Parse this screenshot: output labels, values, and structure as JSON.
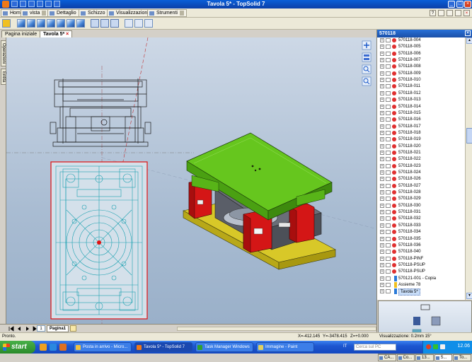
{
  "window": {
    "title": "Tavola 5* - TopSolid 7"
  },
  "menubar": {
    "items": [
      {
        "label": "Home"
      },
      {
        "label": "vista"
      },
      {
        "label": "Dettaglio"
      },
      {
        "label": "Schizzo"
      },
      {
        "label": "Visualizzazione"
      },
      {
        "label": "Strumenti"
      }
    ]
  },
  "tabs": [
    {
      "label": "Pagina iniziale"
    },
    {
      "label": "Tavola 5*"
    }
  ],
  "left_tabs": [
    {
      "label": "Operazioni"
    },
    {
      "label": "Entità"
    }
  ],
  "page_nav": {
    "page_number": "1",
    "sheet_label": "Pagina1"
  },
  "right_panel": {
    "title": "570118",
    "tree": [
      {
        "label": "570118-004"
      },
      {
        "label": "570118-005"
      },
      {
        "label": "570118-006"
      },
      {
        "label": "570118-007"
      },
      {
        "label": "570118-008"
      },
      {
        "label": "570118-009"
      },
      {
        "label": "570118-010"
      },
      {
        "label": "570118-011"
      },
      {
        "label": "570118-012"
      },
      {
        "label": "570118-013"
      },
      {
        "label": "570118-014"
      },
      {
        "label": "570118-015"
      },
      {
        "label": "570118-016"
      },
      {
        "label": "570118-017"
      },
      {
        "label": "570118-018"
      },
      {
        "label": "570118-019"
      },
      {
        "label": "570118-020"
      },
      {
        "label": "570118-021"
      },
      {
        "label": "570118-022"
      },
      {
        "label": "570118-023"
      },
      {
        "label": "570118-024"
      },
      {
        "label": "570118-026"
      },
      {
        "label": "570118-027"
      },
      {
        "label": "570118-028"
      },
      {
        "label": "570118-029"
      },
      {
        "label": "570118-030"
      },
      {
        "label": "570118-031"
      },
      {
        "label": "570118-032"
      },
      {
        "label": "570118-033"
      },
      {
        "label": "570118-034"
      },
      {
        "label": "570118-035"
      },
      {
        "label": "570118-036"
      },
      {
        "label": "570118-040"
      },
      {
        "label": "570118-PINF"
      },
      {
        "label": "570118-PSUP"
      },
      {
        "label": "570118-PSUP"
      },
      {
        "label": "570121-001 - Copia"
      },
      {
        "label": "Assieme 78"
      },
      {
        "label": "Tavola 5*"
      }
    ],
    "bottom_tabs": [
      {
        "label": "CA..."
      },
      {
        "label": "Co..."
      },
      {
        "label": "13..."
      },
      {
        "label": "S..."
      },
      {
        "label": "To..."
      }
    ]
  },
  "status": {
    "left": "Pronto.",
    "x": "X=-412.145",
    "y": "Y=-3478.415",
    "z": "Z=+0.000",
    "visualization": "Visualizzazione: 0.2mm 15°"
  },
  "taskbar": {
    "start": "start",
    "tasks": [
      {
        "label": "Posta in arrivo - Micro..."
      },
      {
        "label": "Tavola 5* - TopSolid 7"
      },
      {
        "label": "Task Manager Windows"
      },
      {
        "label": "Immagine - Paint"
      }
    ],
    "lang": "IT",
    "search_placeholder": "Cerca sul PC",
    "clock": "12.06"
  },
  "colors": {
    "title_bar": "#0b3fa8",
    "canvas_top": "#cdd8e6",
    "canvas_bottom": "#9ab0c9",
    "part_green": "#66c61e",
    "part_red": "#d41616",
    "part_yellow": "#d8c828",
    "drawing_cyan": "#1aa0b0",
    "sheet_border": "#e01010"
  }
}
